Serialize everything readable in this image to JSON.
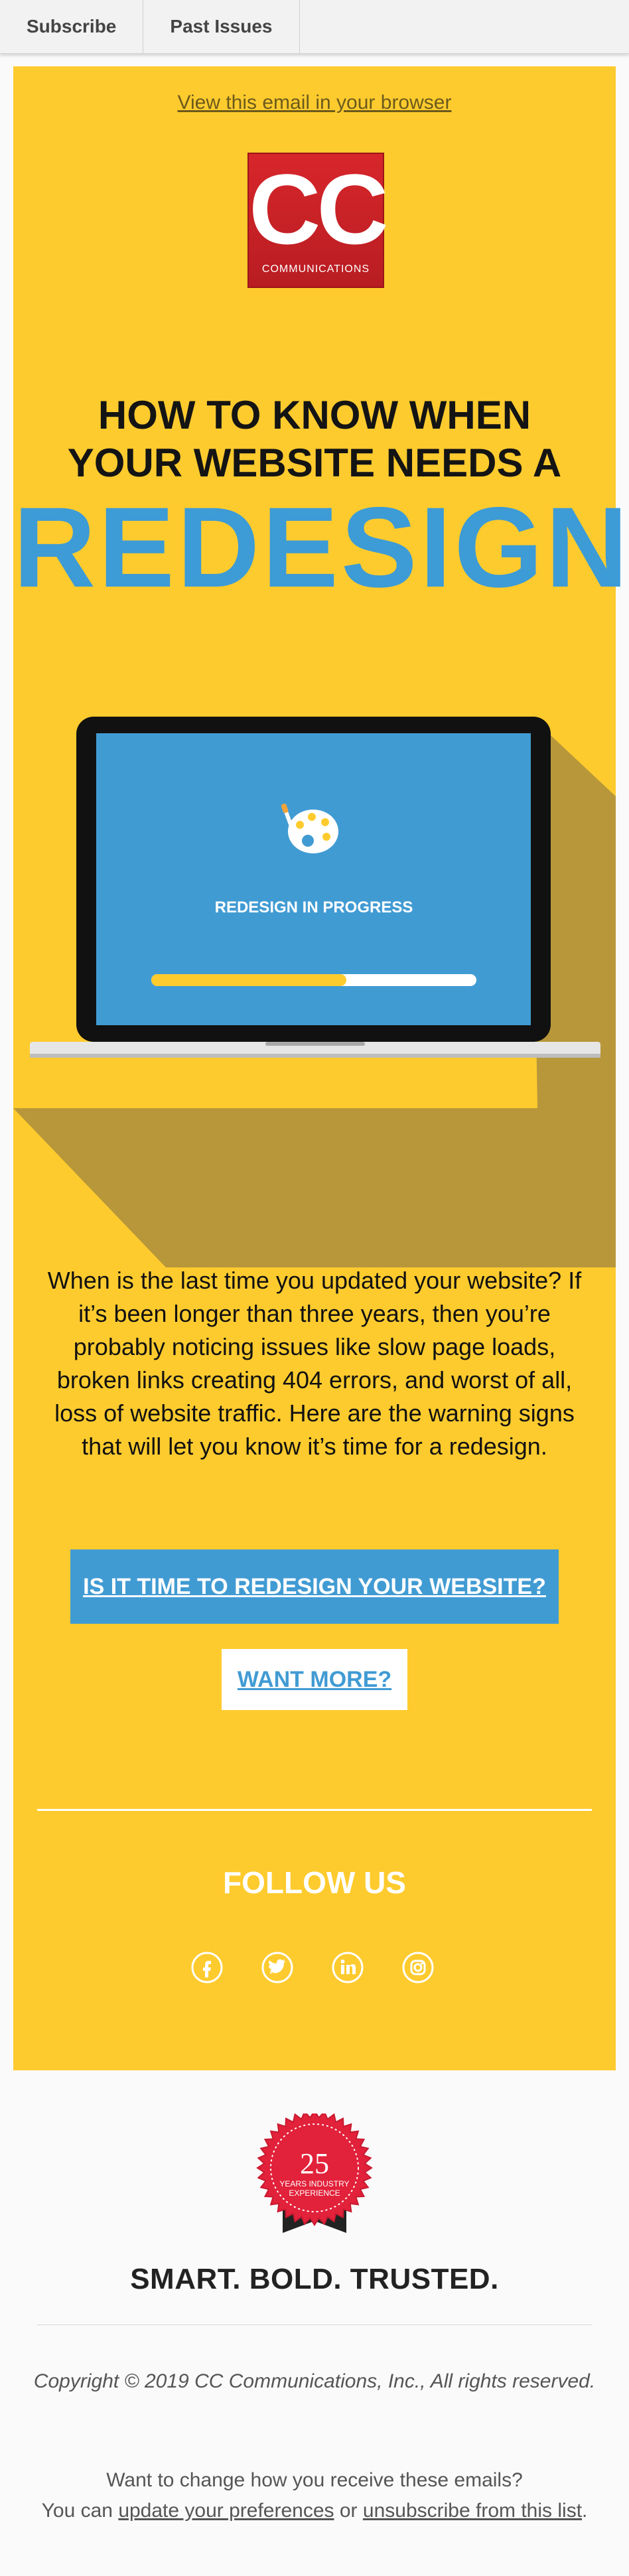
{
  "nav": {
    "subscribe": "Subscribe",
    "past_issues": "Past Issues"
  },
  "email": {
    "view_in_browser": "View this email in your browser",
    "logo": {
      "letters": "CC",
      "subtitle": "COMMUNICATIONS"
    },
    "headline_line1": "HOW TO KNOW WHEN",
    "headline_line2": "YOUR WEBSITE NEEDS A",
    "headline_big": "REDESIGN",
    "illustration": {
      "screen_label": "REDESIGN IN PROGRESS",
      "progress": 0.6,
      "icon": "palette-icon"
    },
    "body": "When is the last time you updated your website? If it’s been longer than three years, then you’re probably noticing issues like slow page loads, broken links creating 404 errors, and worst of all, loss of website traffic. Here are the warning signs that will let you know it’s time for a redesign.",
    "cta_primary": "IS IT TIME TO REDESIGN YOUR WEBSITE?",
    "cta_secondary": "WANT MORE?",
    "follow_title": "FOLLOW US",
    "social": [
      "facebook-icon",
      "twitter-icon",
      "linkedin-icon",
      "instagram-icon"
    ]
  },
  "footer": {
    "badge": {
      "number": "25",
      "line1": "YEARS INDUSTRY",
      "line2": "EXPERIENCE"
    },
    "tagline": "SMART. BOLD. TRUSTED.",
    "copyright": "Copyright © 2019 CC Communications, Inc., All rights reserved.",
    "prefs_question": "Want to change how you receive these emails?",
    "prefs_you_can": "You can",
    "prefs_update": "update your preferences",
    "prefs_or": "or",
    "prefs_unsubscribe": "unsubscribe from this list",
    "prefs_end": "."
  },
  "colors": {
    "card_bg": "#fecb2e",
    "accent_blue": "#419bd3",
    "logo_red": "#d7262b",
    "shadow": "#b8973a"
  }
}
